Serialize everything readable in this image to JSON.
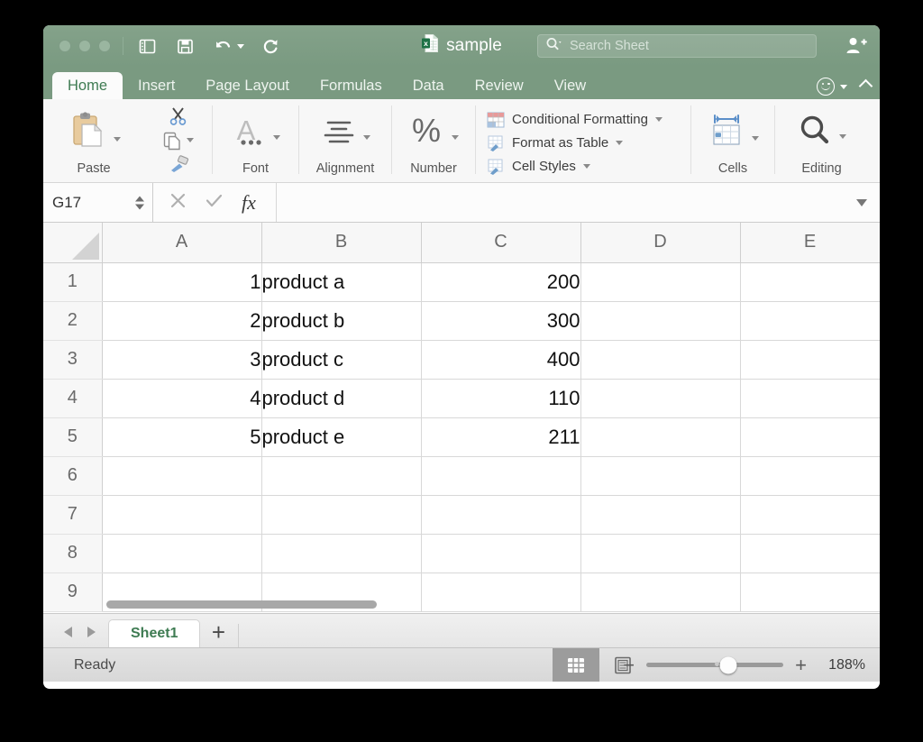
{
  "titlebar": {
    "document_name": "sample",
    "document_icon": "excel-file-icon",
    "quick_access": [
      {
        "name": "sidebar-toggle-icon",
        "label": "Sidebar"
      },
      {
        "name": "save-icon",
        "label": "Save"
      },
      {
        "name": "undo-icon",
        "label": "Undo"
      },
      {
        "name": "redo-icon",
        "label": "Redo"
      }
    ],
    "search_placeholder": "Search Sheet",
    "search_icon": "search-icon",
    "share_icon": "add-person-icon",
    "bg_color": "#7a9a81"
  },
  "ribbon_tabs": {
    "items": [
      {
        "label": "Home",
        "active": true
      },
      {
        "label": "Insert",
        "active": false
      },
      {
        "label": "Page Layout",
        "active": false
      },
      {
        "label": "Formulas",
        "active": false
      },
      {
        "label": "Data",
        "active": false
      },
      {
        "label": "Review",
        "active": false
      },
      {
        "label": "View",
        "active": false
      }
    ],
    "smiley_icon": "smiley-face-icon",
    "collapse_icon": "chevron-up-icon",
    "active_text_color": "#3e7b52"
  },
  "ribbon": {
    "groups": [
      {
        "label": "Paste",
        "icon": "clipboard-paste-icon"
      },
      {
        "label": "Font",
        "icon": "font-icon"
      },
      {
        "label": "Alignment",
        "icon": "alignment-icon"
      },
      {
        "label": "Number",
        "icon": "percent-icon"
      },
      {
        "label": "Cells",
        "icon": "cells-icon"
      },
      {
        "label": "Editing",
        "icon": "magnifier-icon"
      }
    ],
    "clipboard_tools": [
      {
        "label": "Cut",
        "icon": "scissors-icon"
      },
      {
        "label": "Copy",
        "icon": "copy-icon"
      },
      {
        "label": "Format Painter",
        "icon": "format-painter-icon"
      }
    ],
    "styles_list": [
      {
        "label": "Conditional Formatting",
        "icon": "conditional-formatting-icon"
      },
      {
        "label": "Format as Table",
        "icon": "format-as-table-icon"
      },
      {
        "label": "Cell Styles",
        "icon": "cell-styles-icon"
      }
    ]
  },
  "formula_bar": {
    "name_box_value": "G17",
    "formula_value": "",
    "cancel_icon": "cancel-x-icon",
    "confirm_icon": "confirm-check-icon",
    "function_icon": "fx-icon",
    "expand_icon": "chevron-down-icon"
  },
  "grid": {
    "columns": [
      "A",
      "B",
      "C",
      "D",
      "E"
    ],
    "rows": [
      {
        "num": "1",
        "cells": [
          "1",
          "product a",
          "200",
          "",
          ""
        ]
      },
      {
        "num": "2",
        "cells": [
          "2",
          "product b",
          "300",
          "",
          ""
        ]
      },
      {
        "num": "3",
        "cells": [
          "3",
          "product c",
          "400",
          "",
          ""
        ]
      },
      {
        "num": "4",
        "cells": [
          "4",
          "product d",
          "110",
          "",
          ""
        ]
      },
      {
        "num": "5",
        "cells": [
          "5",
          "product e",
          "211",
          "",
          ""
        ]
      },
      {
        "num": "6",
        "cells": [
          "",
          "",
          "",
          "",
          ""
        ]
      },
      {
        "num": "7",
        "cells": [
          "",
          "",
          "",
          "",
          ""
        ]
      },
      {
        "num": "8",
        "cells": [
          "",
          "",
          "",
          "",
          ""
        ]
      },
      {
        "num": "9",
        "cells": [
          "",
          "",
          "",
          "",
          ""
        ]
      }
    ],
    "alignments": [
      "num",
      "txt",
      "num",
      "txt",
      "txt"
    ]
  },
  "sheet_bar": {
    "prev_icon": "prev-sheet-arrow-icon",
    "next_icon": "next-sheet-arrow-icon",
    "tabs": [
      {
        "label": "Sheet1",
        "active": true
      }
    ],
    "add_label": "+"
  },
  "status_bar": {
    "status_text": "Ready",
    "view_modes": [
      {
        "name": "normal-view-icon",
        "active": true
      },
      {
        "name": "page-layout-view-icon",
        "active": false
      }
    ],
    "zoom_out_label": "−",
    "zoom_in_label": "+",
    "zoom_value": "188%"
  }
}
